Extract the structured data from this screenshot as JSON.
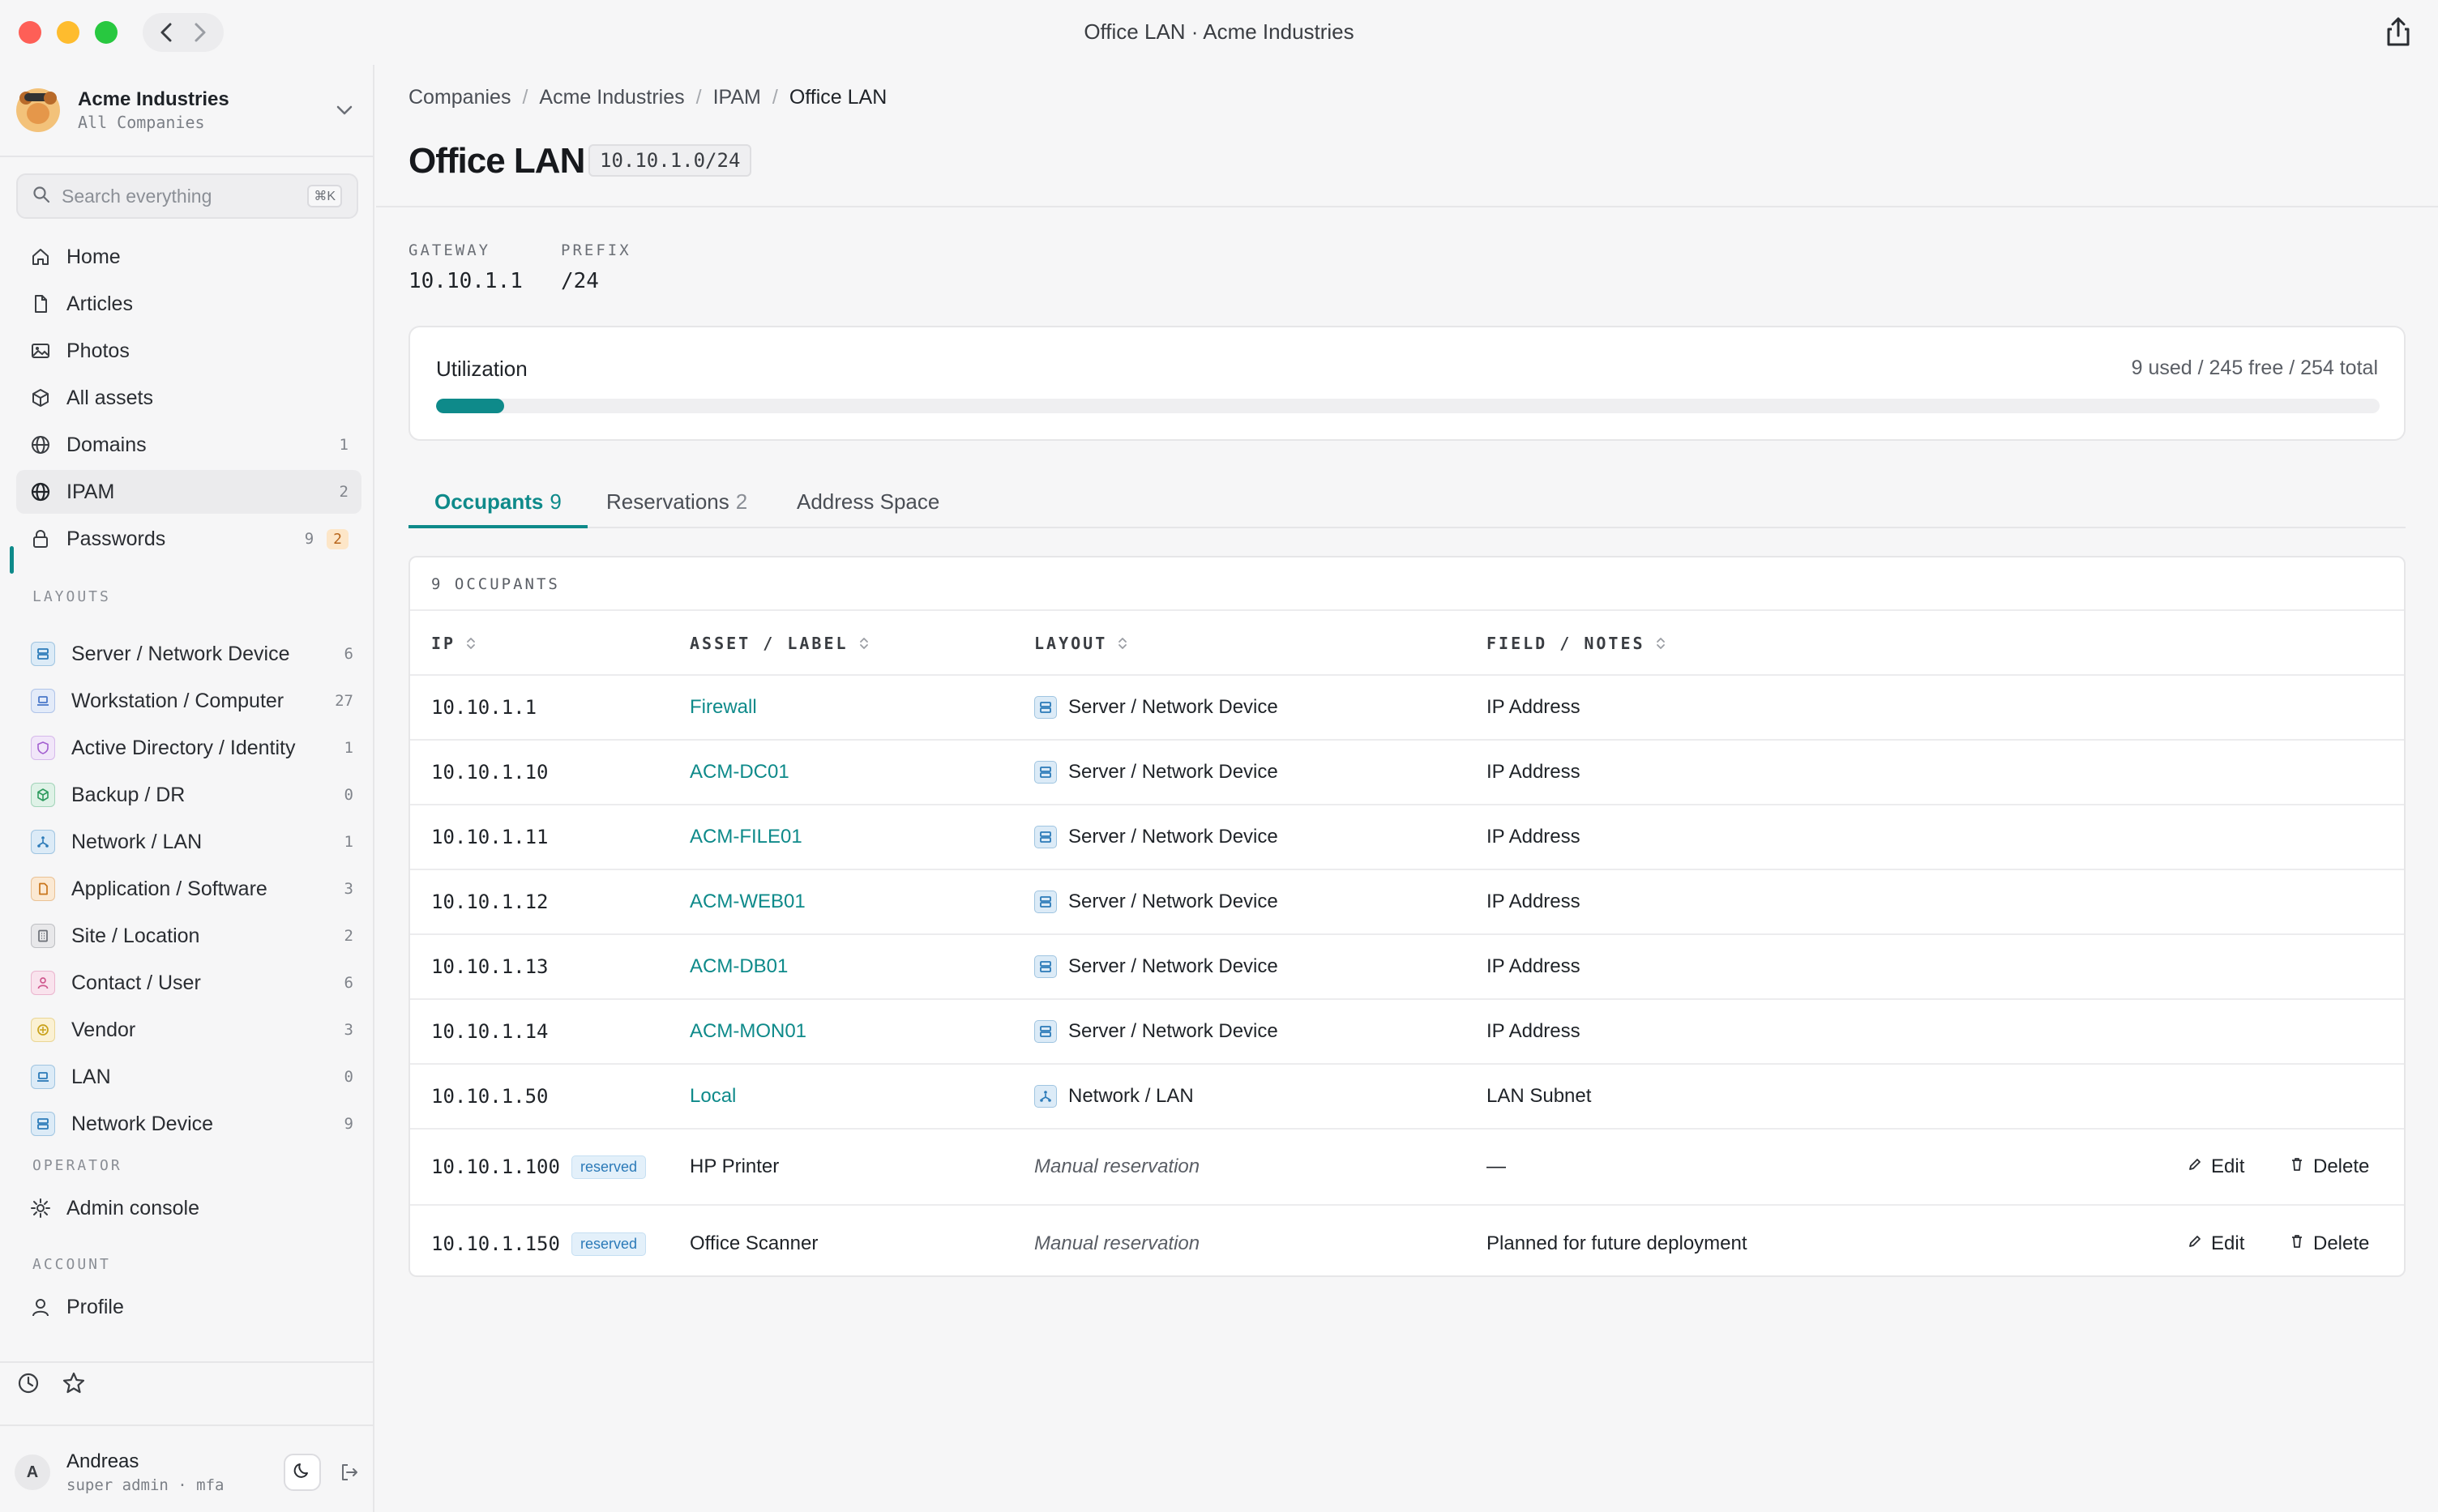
{
  "window": {
    "title": "Office LAN · Acme Industries"
  },
  "sidebar": {
    "company_name": "Acme Industries",
    "company_sub": "All Companies",
    "search_placeholder": "Search everything",
    "search_shortcut": "⌘K",
    "nav": [
      {
        "label": "Home",
        "icon": "home-icon",
        "count": ""
      },
      {
        "label": "Articles",
        "icon": "document-icon",
        "count": ""
      },
      {
        "label": "Photos",
        "icon": "image-icon",
        "count": ""
      },
      {
        "label": "All assets",
        "icon": "cube-icon",
        "count": ""
      },
      {
        "label": "Domains",
        "icon": "globe-icon",
        "count": "1"
      },
      {
        "label": "IPAM",
        "icon": "globe-icon",
        "count": "2"
      },
      {
        "label": "Passwords",
        "icon": "lock-icon",
        "count": "9",
        "badge": "2"
      }
    ],
    "layouts_heading": "LAYOUTS",
    "layouts": [
      {
        "label": "Server / Network Device",
        "count": "6",
        "icon": "server-icon",
        "color": "#2b7ab8",
        "bg": "#dcebf7"
      },
      {
        "label": "Workstation / Computer",
        "count": "27",
        "icon": "laptop-icon",
        "color": "#4a78c9",
        "bg": "#e3ebf9"
      },
      {
        "label": "Active Directory / Identity",
        "count": "1",
        "icon": "shield-icon",
        "color": "#a35fd0",
        "bg": "#f1e6f9"
      },
      {
        "label": "Backup / DR",
        "count": "0",
        "icon": "box-icon",
        "color": "#2e9a5e",
        "bg": "#dff2e7"
      },
      {
        "label": "Network / LAN",
        "count": "1",
        "icon": "network-icon",
        "color": "#2b7ab8",
        "bg": "#dcebf7"
      },
      {
        "label": "Application / Software",
        "count": "3",
        "icon": "file-icon",
        "color": "#c9751b",
        "bg": "#fbe9d3"
      },
      {
        "label": "Site / Location",
        "count": "2",
        "icon": "building-icon",
        "color": "#6b6f76",
        "bg": "#e8e8ea"
      },
      {
        "label": "Contact / User",
        "count": "6",
        "icon": "person-icon",
        "color": "#d05a8f",
        "bg": "#f9e3ed"
      },
      {
        "label": "Vendor",
        "count": "3",
        "icon": "vendor-icon",
        "color": "#c9a21b",
        "bg": "#fbf1d3"
      },
      {
        "label": "LAN",
        "count": "0",
        "icon": "laptop-icon",
        "color": "#2b7ab8",
        "bg": "#dcebf7"
      },
      {
        "label": "Network Device",
        "count": "9",
        "icon": "server-icon",
        "color": "#2b7ab8",
        "bg": "#dcebf7"
      }
    ],
    "operator_heading": "OPERATOR",
    "admin_console": "Admin console",
    "account_heading": "ACCOUNT",
    "profile": "Profile",
    "user_initial": "A",
    "user_name": "Andreas",
    "user_sub": "super admin · mfa"
  },
  "breadcrumb": [
    "Companies",
    "Acme Industries",
    "IPAM",
    "Office LAN"
  ],
  "page": {
    "title": "Office LAN",
    "cidr": "10.10.1.0/24",
    "gateway_label": "GATEWAY",
    "gateway": "10.10.1.1",
    "prefix_label": "PREFIX",
    "prefix": "/24"
  },
  "utilization": {
    "title": "Utilization",
    "stats": "9 used / 245 free / 254 total",
    "fraction": 0.035
  },
  "tabs": [
    {
      "label": "Occupants",
      "count": "9",
      "active": true
    },
    {
      "label": "Reservations",
      "count": "2",
      "active": false
    },
    {
      "label": "Address Space",
      "count": "",
      "active": false
    }
  ],
  "table": {
    "caption": "9 OCCUPANTS",
    "headers": {
      "ip": "IP",
      "asset": "ASSET / LABEL",
      "layout": "LAYOUT",
      "notes": "FIELD / NOTES"
    },
    "rows": [
      {
        "ip": "10.10.1.1",
        "asset": "Firewall",
        "layout": "Server / Network Device",
        "layout_icon": "server-icon",
        "notes": "IP Address"
      },
      {
        "ip": "10.10.1.10",
        "asset": "ACM-DC01",
        "layout": "Server / Network Device",
        "layout_icon": "server-icon",
        "notes": "IP Address"
      },
      {
        "ip": "10.10.1.11",
        "asset": "ACM-FILE01",
        "layout": "Server / Network Device",
        "layout_icon": "server-icon",
        "notes": "IP Address"
      },
      {
        "ip": "10.10.1.12",
        "asset": "ACM-WEB01",
        "layout": "Server / Network Device",
        "layout_icon": "server-icon",
        "notes": "IP Address"
      },
      {
        "ip": "10.10.1.13",
        "asset": "ACM-DB01",
        "layout": "Server / Network Device",
        "layout_icon": "server-icon",
        "notes": "IP Address"
      },
      {
        "ip": "10.10.1.14",
        "asset": "ACM-MON01",
        "layout": "Server / Network Device",
        "layout_icon": "server-icon",
        "notes": "IP Address"
      },
      {
        "ip": "10.10.1.50",
        "asset": "Local",
        "layout": "Network / LAN",
        "layout_icon": "network-icon",
        "notes": "LAN Subnet"
      }
    ],
    "reservations": [
      {
        "ip": "10.10.1.100",
        "badge": "reserved",
        "asset": "HP Printer",
        "layout": "Manual reservation",
        "notes": "—",
        "edit": "Edit",
        "delete": "Delete"
      },
      {
        "ip": "10.10.1.150",
        "badge": "reserved",
        "asset": "Office Scanner",
        "layout": "Manual reservation",
        "notes": "Planned for future deployment",
        "edit": "Edit",
        "delete": "Delete"
      }
    ]
  },
  "colors": {
    "accent": "#0e8a8a",
    "reserved": "#2b7ab8"
  }
}
